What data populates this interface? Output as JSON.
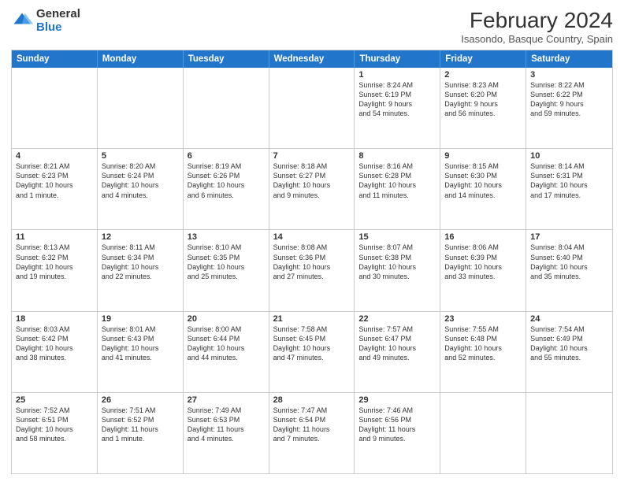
{
  "header": {
    "title": "February 2024",
    "subtitle": "Isasondo, Basque Country, Spain",
    "logo_general": "General",
    "logo_blue": "Blue"
  },
  "weekdays": [
    "Sunday",
    "Monday",
    "Tuesday",
    "Wednesday",
    "Thursday",
    "Friday",
    "Saturday"
  ],
  "rows": [
    [
      {
        "day": "",
        "info": ""
      },
      {
        "day": "",
        "info": ""
      },
      {
        "day": "",
        "info": ""
      },
      {
        "day": "",
        "info": ""
      },
      {
        "day": "1",
        "info": "Sunrise: 8:24 AM\nSunset: 6:19 PM\nDaylight: 9 hours\nand 54 minutes."
      },
      {
        "day": "2",
        "info": "Sunrise: 8:23 AM\nSunset: 6:20 PM\nDaylight: 9 hours\nand 56 minutes."
      },
      {
        "day": "3",
        "info": "Sunrise: 8:22 AM\nSunset: 6:22 PM\nDaylight: 9 hours\nand 59 minutes."
      }
    ],
    [
      {
        "day": "4",
        "info": "Sunrise: 8:21 AM\nSunset: 6:23 PM\nDaylight: 10 hours\nand 1 minute."
      },
      {
        "day": "5",
        "info": "Sunrise: 8:20 AM\nSunset: 6:24 PM\nDaylight: 10 hours\nand 4 minutes."
      },
      {
        "day": "6",
        "info": "Sunrise: 8:19 AM\nSunset: 6:26 PM\nDaylight: 10 hours\nand 6 minutes."
      },
      {
        "day": "7",
        "info": "Sunrise: 8:18 AM\nSunset: 6:27 PM\nDaylight: 10 hours\nand 9 minutes."
      },
      {
        "day": "8",
        "info": "Sunrise: 8:16 AM\nSunset: 6:28 PM\nDaylight: 10 hours\nand 11 minutes."
      },
      {
        "day": "9",
        "info": "Sunrise: 8:15 AM\nSunset: 6:30 PM\nDaylight: 10 hours\nand 14 minutes."
      },
      {
        "day": "10",
        "info": "Sunrise: 8:14 AM\nSunset: 6:31 PM\nDaylight: 10 hours\nand 17 minutes."
      }
    ],
    [
      {
        "day": "11",
        "info": "Sunrise: 8:13 AM\nSunset: 6:32 PM\nDaylight: 10 hours\nand 19 minutes."
      },
      {
        "day": "12",
        "info": "Sunrise: 8:11 AM\nSunset: 6:34 PM\nDaylight: 10 hours\nand 22 minutes."
      },
      {
        "day": "13",
        "info": "Sunrise: 8:10 AM\nSunset: 6:35 PM\nDaylight: 10 hours\nand 25 minutes."
      },
      {
        "day": "14",
        "info": "Sunrise: 8:08 AM\nSunset: 6:36 PM\nDaylight: 10 hours\nand 27 minutes."
      },
      {
        "day": "15",
        "info": "Sunrise: 8:07 AM\nSunset: 6:38 PM\nDaylight: 10 hours\nand 30 minutes."
      },
      {
        "day": "16",
        "info": "Sunrise: 8:06 AM\nSunset: 6:39 PM\nDaylight: 10 hours\nand 33 minutes."
      },
      {
        "day": "17",
        "info": "Sunrise: 8:04 AM\nSunset: 6:40 PM\nDaylight: 10 hours\nand 35 minutes."
      }
    ],
    [
      {
        "day": "18",
        "info": "Sunrise: 8:03 AM\nSunset: 6:42 PM\nDaylight: 10 hours\nand 38 minutes."
      },
      {
        "day": "19",
        "info": "Sunrise: 8:01 AM\nSunset: 6:43 PM\nDaylight: 10 hours\nand 41 minutes."
      },
      {
        "day": "20",
        "info": "Sunrise: 8:00 AM\nSunset: 6:44 PM\nDaylight: 10 hours\nand 44 minutes."
      },
      {
        "day": "21",
        "info": "Sunrise: 7:58 AM\nSunset: 6:45 PM\nDaylight: 10 hours\nand 47 minutes."
      },
      {
        "day": "22",
        "info": "Sunrise: 7:57 AM\nSunset: 6:47 PM\nDaylight: 10 hours\nand 49 minutes."
      },
      {
        "day": "23",
        "info": "Sunrise: 7:55 AM\nSunset: 6:48 PM\nDaylight: 10 hours\nand 52 minutes."
      },
      {
        "day": "24",
        "info": "Sunrise: 7:54 AM\nSunset: 6:49 PM\nDaylight: 10 hours\nand 55 minutes."
      }
    ],
    [
      {
        "day": "25",
        "info": "Sunrise: 7:52 AM\nSunset: 6:51 PM\nDaylight: 10 hours\nand 58 minutes."
      },
      {
        "day": "26",
        "info": "Sunrise: 7:51 AM\nSunset: 6:52 PM\nDaylight: 11 hours\nand 1 minute."
      },
      {
        "day": "27",
        "info": "Sunrise: 7:49 AM\nSunset: 6:53 PM\nDaylight: 11 hours\nand 4 minutes."
      },
      {
        "day": "28",
        "info": "Sunrise: 7:47 AM\nSunset: 6:54 PM\nDaylight: 11 hours\nand 7 minutes."
      },
      {
        "day": "29",
        "info": "Sunrise: 7:46 AM\nSunset: 6:56 PM\nDaylight: 11 hours\nand 9 minutes."
      },
      {
        "day": "",
        "info": ""
      },
      {
        "day": "",
        "info": ""
      }
    ]
  ]
}
